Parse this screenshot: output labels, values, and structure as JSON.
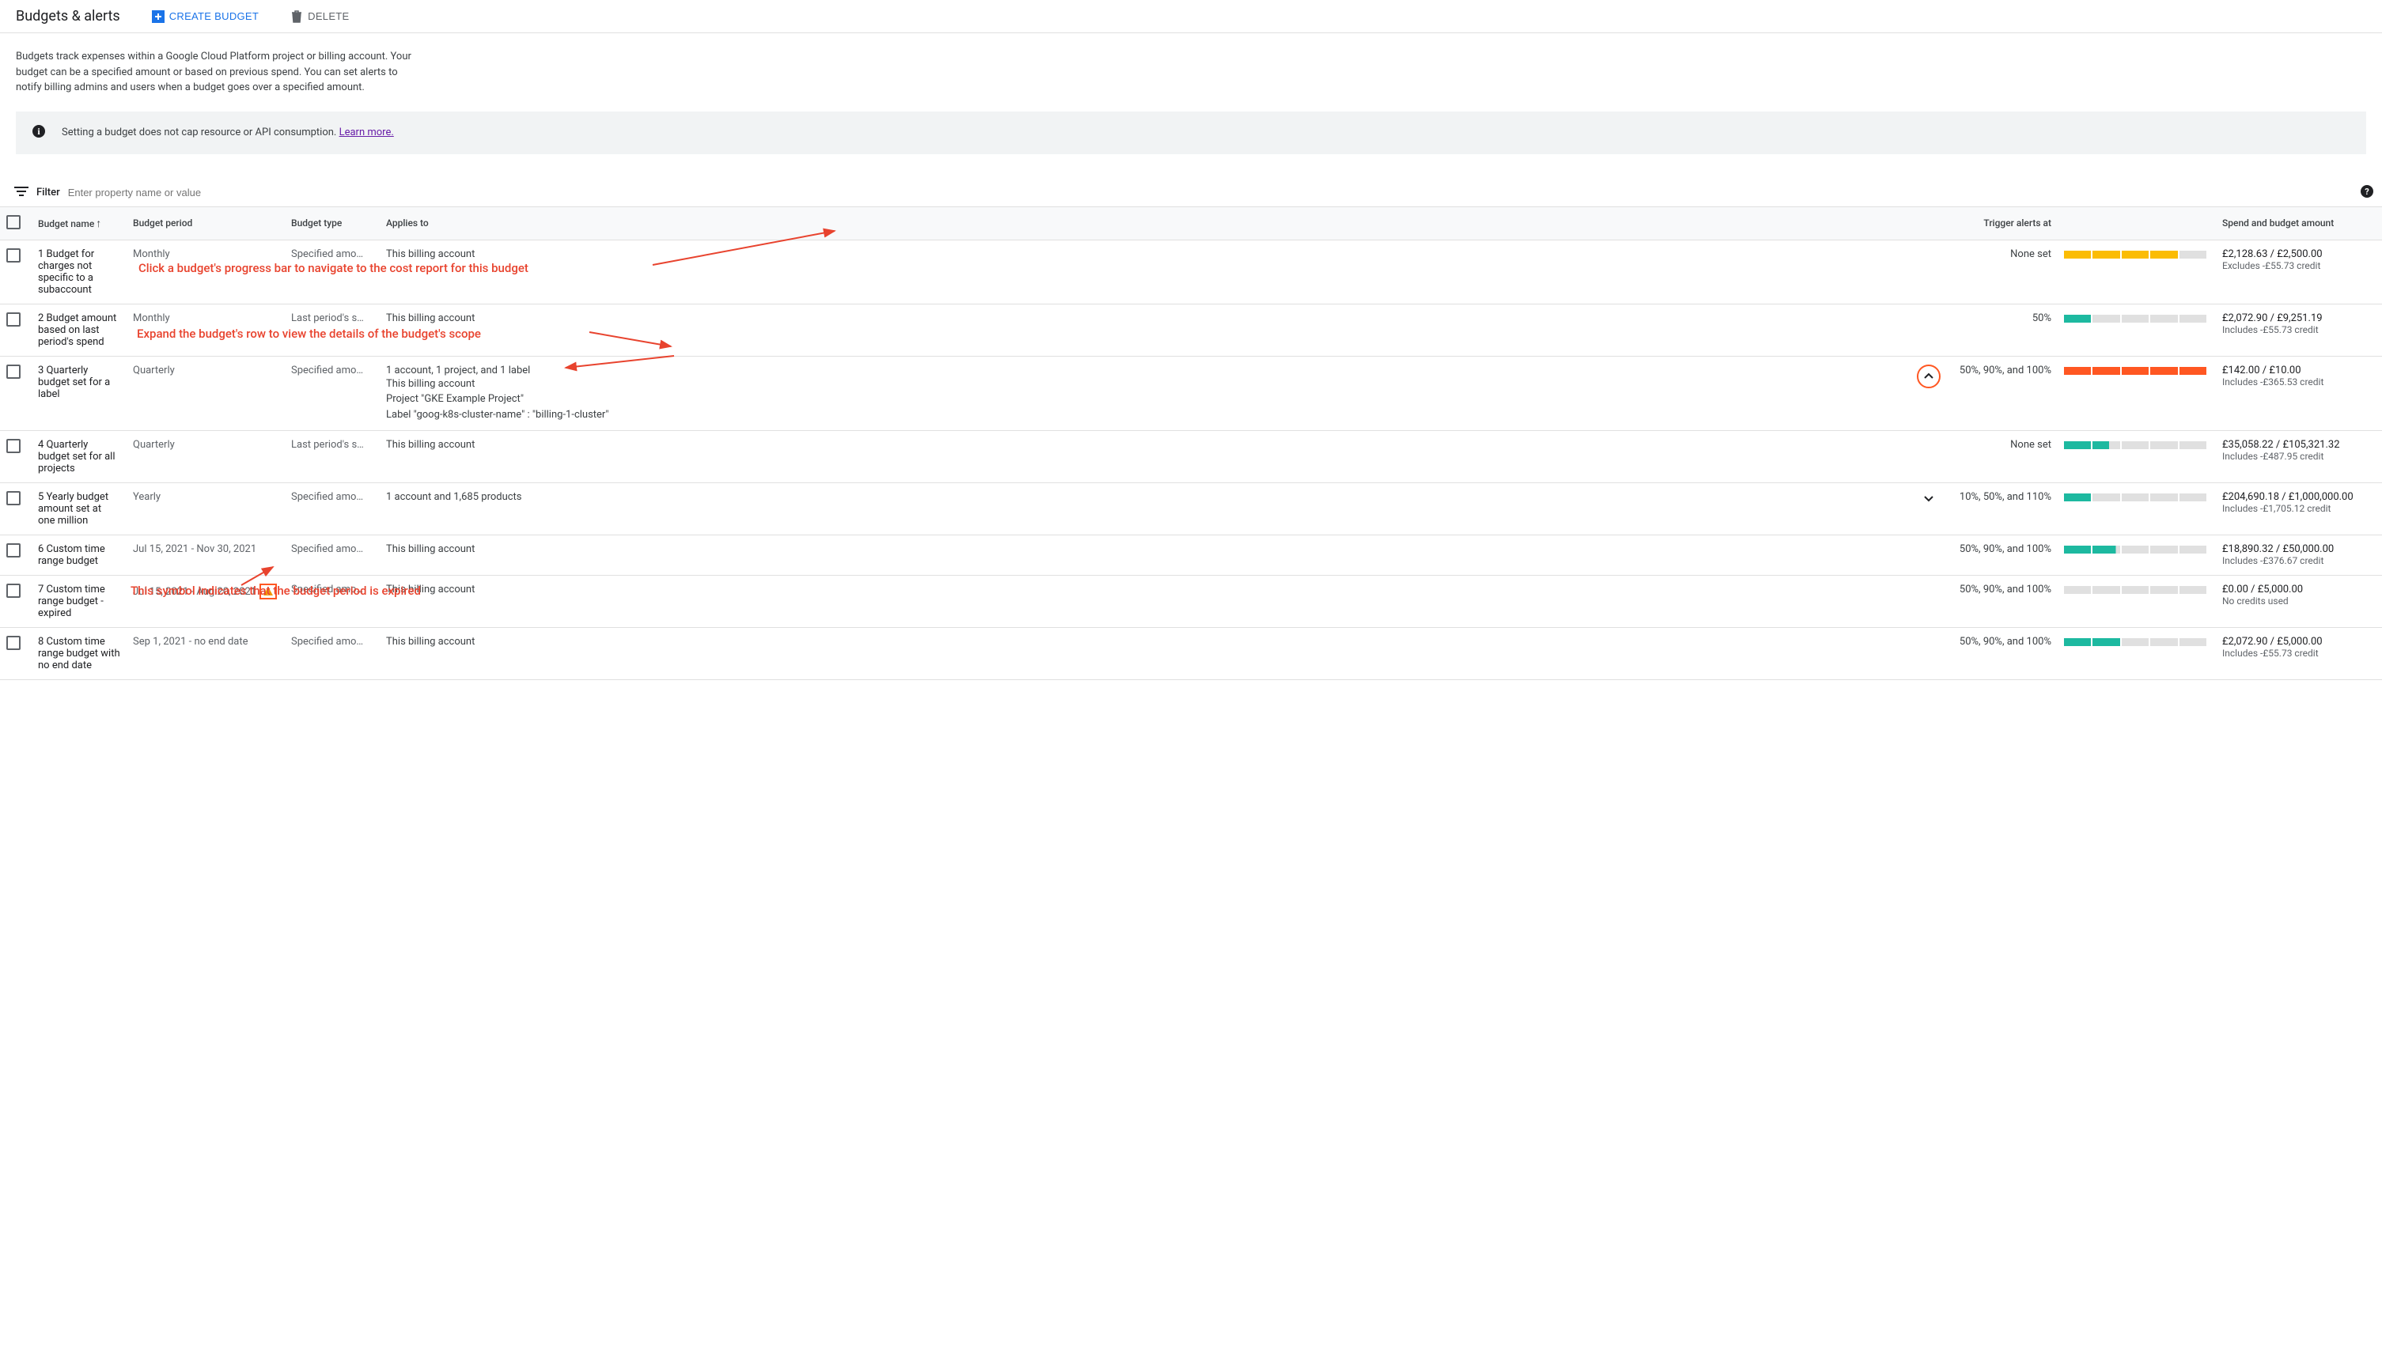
{
  "header": {
    "title": "Budgets & alerts",
    "create_label": "CREATE BUDGET",
    "delete_label": "DELETE"
  },
  "description": "Budgets track expenses within a Google Cloud Platform project or billing account. Your budget can be a specified amount or based on previous spend. You can set alerts to notify billing admins and users when a budget goes over a specified amount.",
  "banner": {
    "text": "Setting a budget does not cap resource or API consumption. ",
    "link": "Learn more."
  },
  "filter": {
    "label": "Filter",
    "placeholder": "Enter property name or value"
  },
  "columns": {
    "name": "Budget name",
    "period": "Budget period",
    "type": "Budget type",
    "applies": "Applies to",
    "trigger": "Trigger alerts at",
    "spend": "Spend and budget amount"
  },
  "rows": [
    {
      "name": "1 Budget for charges not specific to a subaccount",
      "period": "Monthly",
      "type": "Specified amo…",
      "applies": "This billing account",
      "trigger": "None set",
      "segments": [
        "y",
        "y",
        "y",
        "y",
        "e"
      ],
      "seg_partial": [
        100,
        100,
        100,
        100,
        25
      ],
      "amount": "£2,128.63 / £2,500.00",
      "sub": "Excludes -£55.73 credit"
    },
    {
      "name": "2 Budget amount based on last period's spend",
      "period": "Monthly",
      "type": "Last period's s…",
      "applies": "This billing account",
      "trigger": "50%",
      "segments": [
        "t",
        "e",
        "e",
        "e",
        "e"
      ],
      "seg_partial": [
        100,
        10,
        0,
        0,
        0
      ],
      "amount": "£2,072.90 / £9,251.19",
      "sub": "Includes -£55.73 credit"
    },
    {
      "name": "3 Quarterly budget set for a label",
      "period": "Quarterly",
      "type": "Specified amo…",
      "applies": "1 account, 1 project, and 1 label",
      "applies_detail": [
        "This billing account",
        "Project \"GKE Example Project\"",
        "Label \"goog-k8s-cluster-name\" : \"billing-1-cluster\""
      ],
      "expand": "up",
      "expand_circled": true,
      "trigger": "50%, 90%, and 100%",
      "segments": [
        "o",
        "o",
        "o",
        "o",
        "o"
      ],
      "seg_partial": [
        100,
        100,
        100,
        100,
        100
      ],
      "amount": "£142.00 / £10.00",
      "sub": "Includes -£365.53 credit"
    },
    {
      "name": "4 Quarterly budget set for all projects",
      "period": "Quarterly",
      "type": "Last period's s…",
      "applies": "This billing account",
      "trigger": "None set",
      "segments": [
        "t",
        "t",
        "e",
        "e",
        "e"
      ],
      "seg_partial": [
        100,
        60,
        0,
        0,
        0
      ],
      "amount": "£35,058.22 / £105,321.32",
      "sub": "Includes -£487.95 credit"
    },
    {
      "name": "5 Yearly budget amount set at one million",
      "period": "Yearly",
      "type": "Specified amo…",
      "applies": "1 account and 1,685 products",
      "expand": "down",
      "trigger": "10%, 50%, and 110%",
      "segments": [
        "t",
        "e",
        "e",
        "e",
        "e"
      ],
      "seg_partial": [
        100,
        5,
        0,
        0,
        0
      ],
      "amount": "£204,690.18 / £1,000,000.00",
      "sub": "Includes -£1,705.12 credit"
    },
    {
      "name": "6 Custom time range budget",
      "period": "Jul 15, 2021 - Nov 30, 2021",
      "type": "Specified amo…",
      "applies": "This billing account",
      "trigger": "50%, 90%, and 100%",
      "segments": [
        "t",
        "t",
        "e",
        "e",
        "e"
      ],
      "seg_partial": [
        100,
        85,
        0,
        0,
        0
      ],
      "amount": "£18,890.32 / £50,000.00",
      "sub": "Includes -£376.67 credit"
    },
    {
      "name": "7 Custom time range budget - expired",
      "period": "Jul 15, 2021 - Aug 20, 2021",
      "warn": true,
      "type": "Specified amo…",
      "applies": "This billing account",
      "trigger": "50%, 90%, and 100%",
      "segments": [
        "e",
        "e",
        "e",
        "e",
        "e"
      ],
      "seg_partial": [
        0,
        0,
        0,
        0,
        0
      ],
      "amount": "£0.00 / £5,000.00",
      "sub": "No credits used"
    },
    {
      "name": "8 Custom time range budget with no end date",
      "period": "Sep 1, 2021 - no end date",
      "type": "Specified amo…",
      "applies": "This billing account",
      "trigger": "50%, 90%, and 100%",
      "segments": [
        "t",
        "t",
        "e",
        "e",
        "e"
      ],
      "seg_partial": [
        100,
        100,
        10,
        0,
        0
      ],
      "amount": "£2,072.90 / £5,000.00",
      "sub": "Includes -£55.73 credit"
    }
  ],
  "annotations": {
    "a1": "Click a budget's progress bar to navigate to the cost report for this budget",
    "a2": "Expand the budget's row to view the details of the budget's scope",
    "a3": "This symbol indicates that the budget period is expired"
  }
}
